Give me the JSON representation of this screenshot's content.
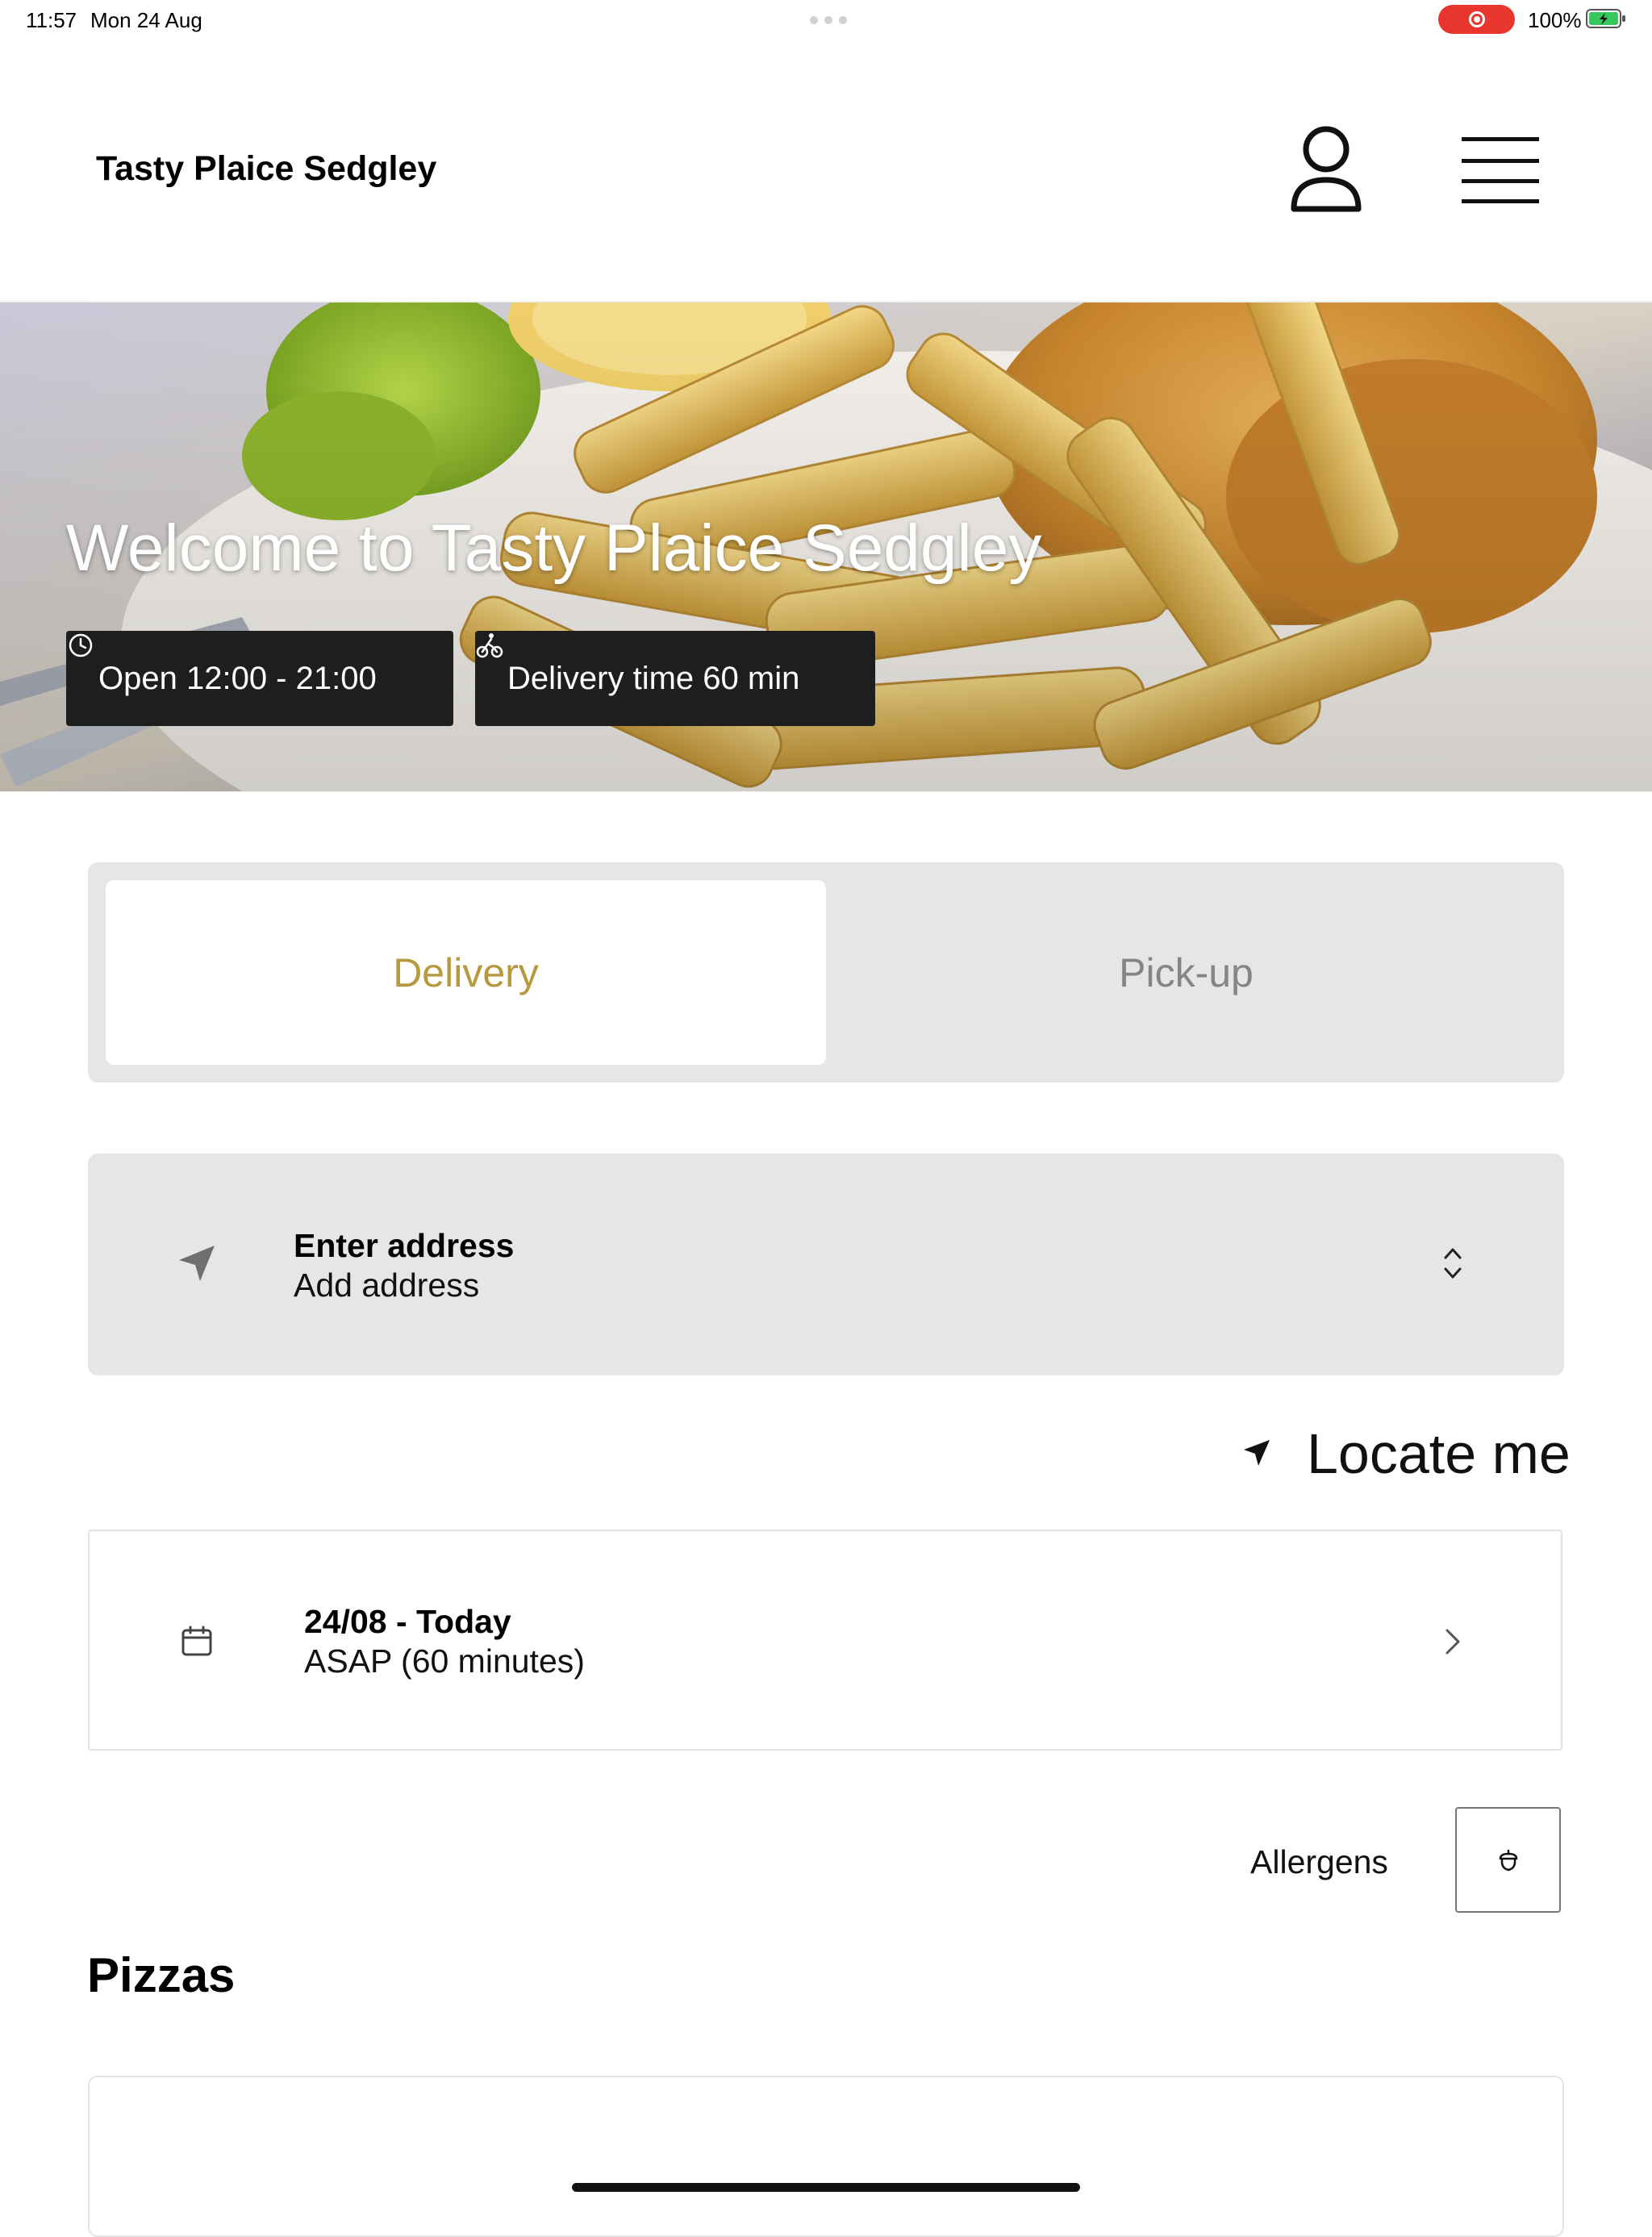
{
  "status_bar": {
    "time": "11:57",
    "date": "Mon 24 Aug",
    "battery": "100%",
    "recording_color": "#e8362f",
    "battery_color": "#34c759"
  },
  "header": {
    "brand": "Tasty Plaice Sedgley",
    "user_icon": "user-icon",
    "menu_icon": "hamburger-menu-icon"
  },
  "hero": {
    "title": "Welcome to Tasty Plaice Sedgley",
    "opening_hours": "Open 12:00 - 21:00",
    "delivery_time": "Delivery time 60 min",
    "clock_icon": "clock-icon",
    "bike_icon": "bicycle-icon"
  },
  "mode_toggle": {
    "options": [
      "Delivery",
      "Pick-up"
    ],
    "selected": "Delivery",
    "accent_color": "#b79a3f"
  },
  "address": {
    "title": "Enter address",
    "subtitle": "Add address"
  },
  "locate": {
    "label": "Locate me"
  },
  "schedule": {
    "date": "24/08 - Today",
    "time": "ASAP (60 minutes)"
  },
  "allergens": {
    "label": "Allergens",
    "icon": "acorn-icon"
  },
  "menu": {
    "section_title": "Pizzas"
  }
}
